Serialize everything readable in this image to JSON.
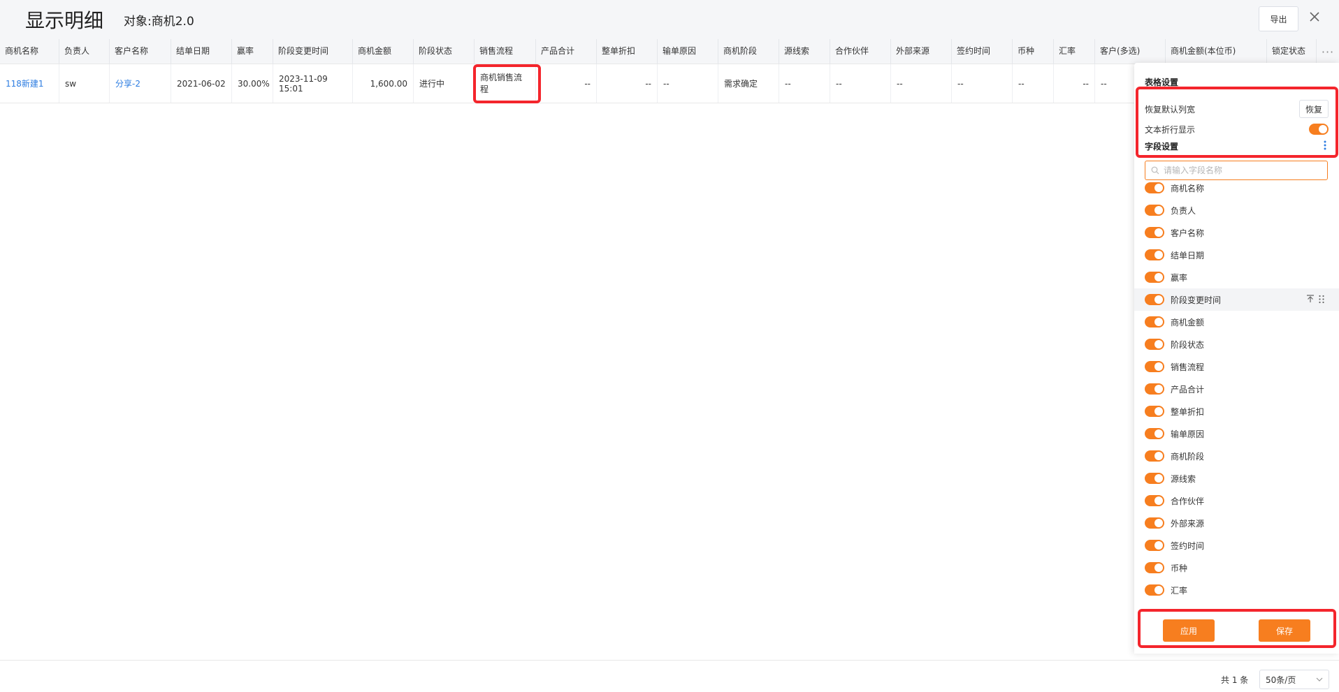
{
  "header": {
    "title": "显示明细",
    "object": "对象:商机2.0",
    "export_label": "导出"
  },
  "table": {
    "columns": [
      "商机名称",
      "负责人",
      "客户名称",
      "结单日期",
      "赢率",
      "阶段变更时间",
      "商机金额",
      "阶段状态",
      "销售流程",
      "产品合计",
      "整单折扣",
      "输单原因",
      "商机阶段",
      "源线索",
      "合作伙伴",
      "外部来源",
      "签约时间",
      "币种",
      "汇率",
      "客户(多选)",
      "商机金额(本位币)",
      "锁定状态"
    ],
    "row": [
      "118新建1",
      "sw",
      "分享-2",
      "2021-06-02",
      "30.00%",
      "2023-11-09 15:01",
      "1,600.00",
      "进行中",
      "商机销售流程",
      "--",
      "--",
      "--",
      "需求确定",
      "--",
      "--",
      "--",
      "--",
      "--",
      "--",
      "--",
      "",
      ""
    ]
  },
  "settings": {
    "title": "表格设置",
    "restore_label": "恢复默认列宽",
    "restore_button": "恢复",
    "wrap_label": "文本折行显示",
    "wrap_on": true,
    "field_title": "字段设置",
    "search_placeholder": "请输入字段名称",
    "fields": [
      "商机名称",
      "负责人",
      "客户名称",
      "结单日期",
      "赢率",
      "阶段变更时间",
      "商机金额",
      "阶段状态",
      "销售流程",
      "产品合计",
      "整单折扣",
      "输单原因",
      "商机阶段",
      "源线索",
      "合作伙伴",
      "外部来源",
      "签约时间",
      "币种",
      "汇率"
    ],
    "apply_label": "应用",
    "save_label": "保存",
    "accent_color": "#f77e1f",
    "highlight_color": "#f4252c"
  },
  "footer": {
    "total": "共 1 条",
    "page_size": "50条/页"
  }
}
